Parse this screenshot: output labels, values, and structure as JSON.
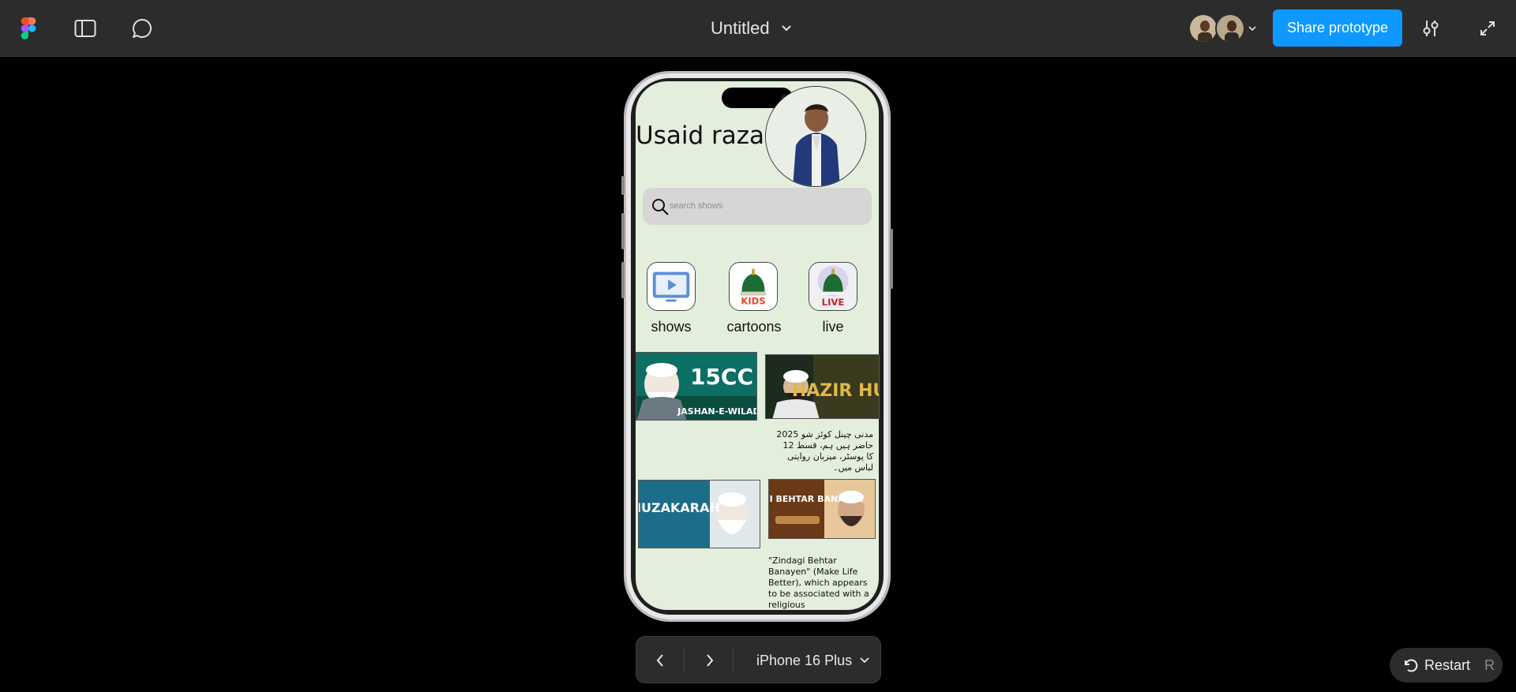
{
  "app": {
    "title": "Untitled",
    "share_label": "Share prototype",
    "icons": [
      "figma-logo",
      "sidebar-icon",
      "comment-icon",
      "chevron-down-icon",
      "settings-sliders-icon",
      "expand-icon"
    ]
  },
  "collaborators": [
    {
      "name": "avatar-1"
    },
    {
      "name": "avatar-2"
    }
  ],
  "profile": {
    "name": "Usaid raza"
  },
  "search": {
    "placeholder": "search shows"
  },
  "categories": [
    {
      "label": "shows",
      "icon": "tv-play-icon"
    },
    {
      "label": "cartoons",
      "icon": "kids-logo",
      "logo_text": "KIDS"
    },
    {
      "label": "live",
      "icon": "live-logo",
      "logo_text": "LIVE"
    }
  ],
  "thumbnails": [
    {
      "title_text": "15CC",
      "subtitle_text": "JASHAN-E-WILADAT"
    },
    {
      "title_text": "HAZIR HUM",
      "caption": "مدنی چینل کوئز شو 2025 حاضر ہیں ہم، قسط 12 کا پوسٹر، میزبان روایتی لباس میں۔"
    },
    {
      "title_text": "MUZAKARAH"
    },
    {
      "title_text": "ZINDAGI BEHTAR BANAYEN",
      "caption": "\"Zindagi Behtar Banayen\" (Make Life Better), which appears to be associated with a religious"
    }
  ],
  "bottom": {
    "device": "iPhone 16 Plus",
    "restart_label": "Restart",
    "restart_key": "R"
  },
  "colors": {
    "topbar": "#2c2c2c",
    "accent": "#0d99ff",
    "screen_bg": "#e3eedc"
  }
}
